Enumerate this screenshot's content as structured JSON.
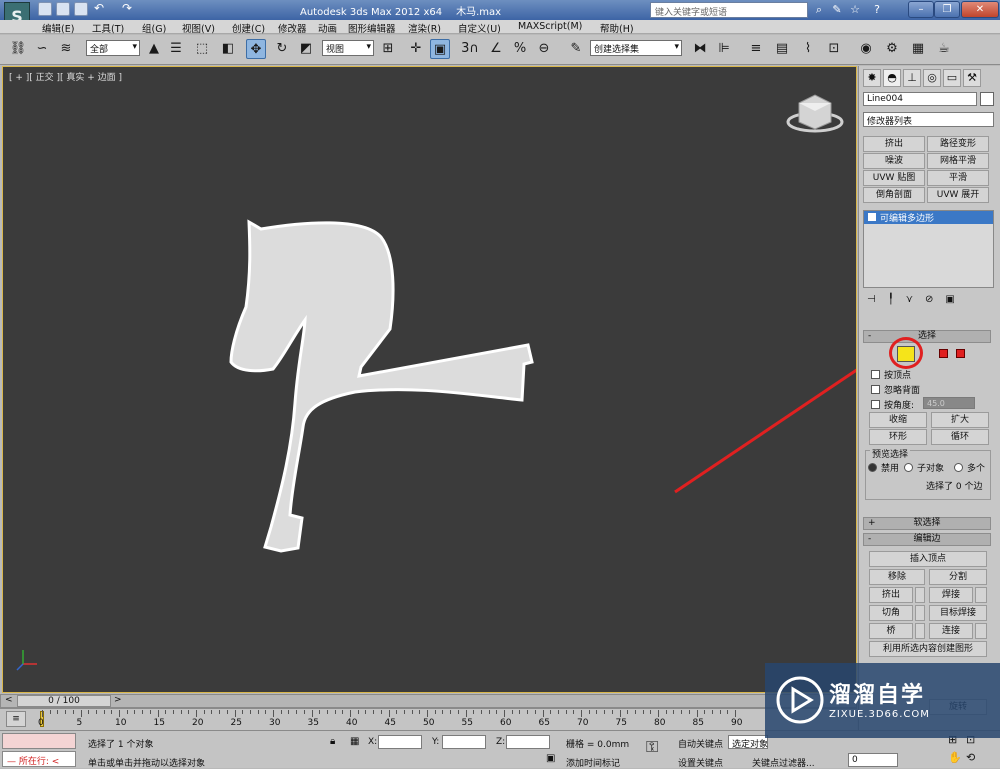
{
  "app": {
    "title": "Autodesk 3ds Max  2012 x64",
    "file": "木马.max",
    "search_placeholder": "键入关键字或短语",
    "logo_letter": "S"
  },
  "menu": [
    "编辑(E)",
    "工具(T)",
    "组(G)",
    "视图(V)",
    "创建(C)",
    "修改器",
    "动画",
    "图形编辑器",
    "渲染(R)",
    "自定义(U)",
    "MAXScript(M)",
    "帮助(H)"
  ],
  "toolbar": {
    "selection_filter": "全部",
    "reference_coord": "视图",
    "named_selection": "创建选择集",
    "snap_label": "3",
    "percent_snap": "%"
  },
  "viewport": {
    "label": "[ + ][ 正交 ][ 真实 + 边面 ]",
    "background": "#3b3b3b",
    "object_color": "#dcdcdc"
  },
  "command_panel": {
    "object_name": "Line004",
    "modifier_list": "修改器列表",
    "modifier_buttons": [
      "挤出",
      "路径变形",
      "噪波",
      "网格平滑",
      "UVW 贴图",
      "平滑",
      "倒角剖面",
      "UVW 展开"
    ],
    "stack_item": "可编辑多边形",
    "rollout_select": "选择",
    "by_vertex": "按顶点",
    "ignore_backface": "忽略背面",
    "by_angle": "按角度:",
    "angle_value": "45.0",
    "shrink": "收缩",
    "grow": "扩大",
    "ring": "环形",
    "loop": "循环",
    "preview_selection": "预览选择",
    "preview_options": [
      "禁用",
      "子对象",
      "多个"
    ],
    "selection_status": "选择了 0 个边",
    "rollout_soft": "软选择",
    "rollout_edit_edges": "编辑边",
    "insert_vertex": "插入顶点",
    "remove": "移除",
    "split": "分割",
    "extrude": "挤出",
    "weld": "焊接",
    "chamfer": "切角",
    "target_weld": "目标焊接",
    "bridge": "桥",
    "connect": "连接",
    "create_shape": "利用所选内容创建图形",
    "spin": "旋转",
    "active_subobject_color": "#f5e41a",
    "highlight_color": "#e02020"
  },
  "timeline": {
    "frame": "0 / 100",
    "ticks": [
      "0",
      "5",
      "10",
      "15",
      "20",
      "25",
      "30",
      "35",
      "40",
      "45",
      "50",
      "55",
      "60",
      "65",
      "70",
      "75",
      "80",
      "85",
      "90"
    ]
  },
  "status": {
    "running": "所在行:",
    "selected": "选择了 1 个对象",
    "prompt": "单击或单击并拖动以选择对象",
    "x_label": "X:",
    "y_label": "Y:",
    "z_label": "Z:",
    "grid": "栅格 = 0.0mm",
    "add_time_tag": "添加时间标记",
    "auto_key": "自动关键点",
    "set_key": "设置关键点",
    "selected_obj": "选定对象",
    "key_filters": "关键点过滤器...",
    "frame_field": "0"
  },
  "watermark": {
    "brand": "溜溜自学",
    "url": "ZIXUE.3D66.COM"
  }
}
